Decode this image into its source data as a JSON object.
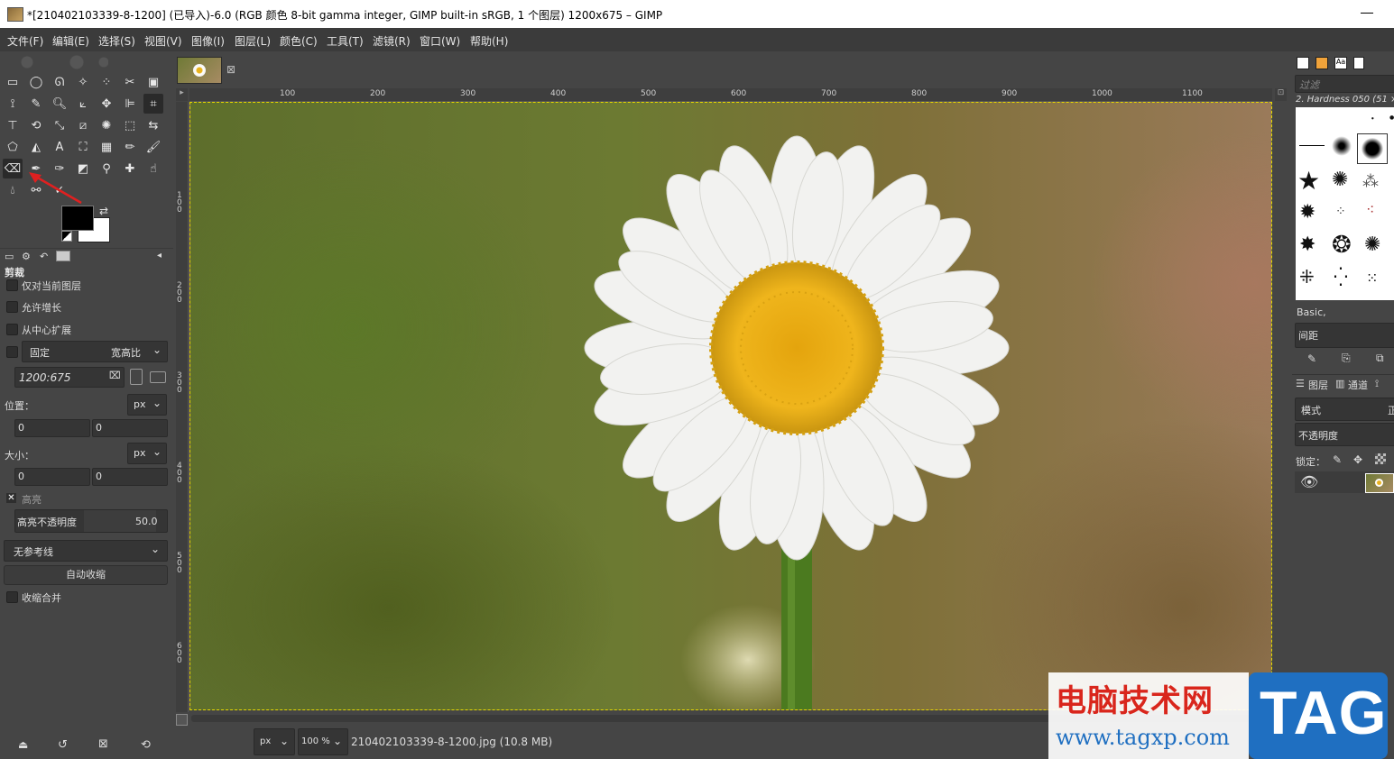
{
  "window": {
    "title": "*[210402103339-8-1200] (已导入)-6.0 (RGB 颜色 8-bit gamma integer, GIMP built-in sRGB, 1 个图层) 1200x675 – GIMP"
  },
  "menu": [
    "文件(F)",
    "编辑(E)",
    "选择(S)",
    "视图(V)",
    "图像(I)",
    "图层(L)",
    "颜色(C)",
    "工具(T)",
    "滤镜(R)",
    "窗口(W)",
    "帮助(H)"
  ],
  "tool_options": {
    "title": "剪裁",
    "current_layer_only": "仅对当前图层",
    "allow_growing": "允许增长",
    "expand_from_center": "从中心扩展",
    "fixed_label": "固定",
    "fixed_mode": "宽高比",
    "ratio_value": "1200:675",
    "position_label": "位置：",
    "position_unit": "px",
    "position_x": "0",
    "position_y": "0",
    "size_label": "大小：",
    "size_unit": "px",
    "size_w": "0",
    "size_h": "0",
    "highlight_label": "高亮",
    "highlight_opacity_label": "高亮不透明度",
    "highlight_opacity_value": "50.0",
    "guides": "无参考线",
    "auto_shrink": "自动收缩",
    "shrink_merged": "收缩合并"
  },
  "ruler": {
    "top": [
      "100",
      "200",
      "300",
      "400",
      "500",
      "600",
      "700",
      "800",
      "900",
      "1000",
      "1100"
    ],
    "left": [
      "100",
      "200",
      "300",
      "400",
      "500",
      "600"
    ]
  },
  "status": {
    "unit": "px",
    "zoom": "100 %",
    "file_info": "210402103339-8-1200.jpg (10.8 MB)"
  },
  "brushes": {
    "filter_placeholder": "过滤",
    "current_brush": "2. Hardness 050 (51 ×",
    "preset": "Basic,",
    "spacing_label": "间距"
  },
  "layers": {
    "tab_layers": "图层",
    "tab_channels": "通道",
    "mode_label": "模式",
    "mode_value": "正",
    "opacity_label": "不透明度",
    "lock_label": "锁定："
  },
  "watermark": {
    "site_name": "电脑技术网",
    "url": "www.tagxp.com",
    "badge": "TAG"
  },
  "colors": {
    "foreground": "#000000",
    "background": "#ffffff",
    "selection_border": "#e8d800",
    "watermark_red": "#d9261c",
    "watermark_blue": "#1f6fc1"
  }
}
